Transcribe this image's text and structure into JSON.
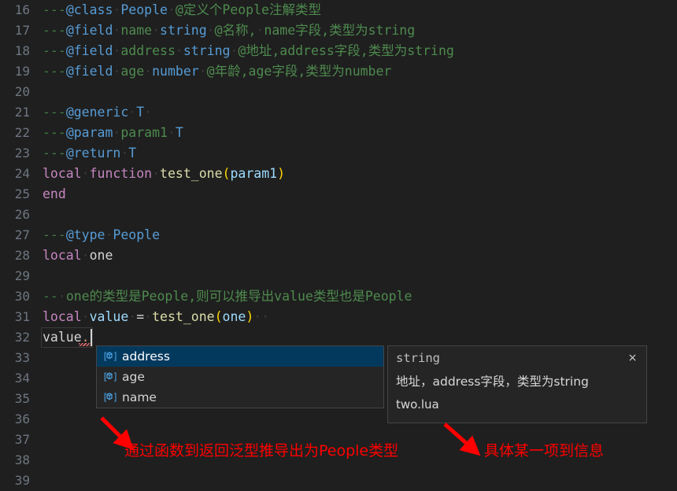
{
  "editor": {
    "language": "lua",
    "theme": "dark",
    "background": "#1f1f1f",
    "gutter_color": "#6e7681",
    "first_line": 16,
    "last_line": 39,
    "lines": [
      {
        "num": "16",
        "tokens": [
          {
            "t": "---",
            "c": "t-dash"
          },
          {
            "t": "@class",
            "c": "t-tag"
          },
          {
            "t": "·",
            "c": "t-ws"
          },
          {
            "t": "People",
            "c": "t-type"
          },
          {
            "t": "·",
            "c": "t-ws"
          },
          {
            "t": "@定义个People注解类型",
            "c": "t-cmt"
          }
        ]
      },
      {
        "num": "17",
        "tokens": [
          {
            "t": "---",
            "c": "t-dash"
          },
          {
            "t": "@field",
            "c": "t-tag"
          },
          {
            "t": "·",
            "c": "t-ws"
          },
          {
            "t": "name",
            "c": "t-param"
          },
          {
            "t": "·",
            "c": "t-ws"
          },
          {
            "t": "string",
            "c": "t-type"
          },
          {
            "t": "·",
            "c": "t-ws"
          },
          {
            "t": "@名称,",
            "c": "t-cmt"
          },
          {
            "t": "·",
            "c": "t-ws"
          },
          {
            "t": "name字段,类型为string",
            "c": "t-cmt"
          }
        ]
      },
      {
        "num": "18",
        "tokens": [
          {
            "t": "---",
            "c": "t-dash"
          },
          {
            "t": "@field",
            "c": "t-tag"
          },
          {
            "t": "·",
            "c": "t-ws"
          },
          {
            "t": "address",
            "c": "t-param"
          },
          {
            "t": "·",
            "c": "t-ws"
          },
          {
            "t": "string",
            "c": "t-type"
          },
          {
            "t": "·",
            "c": "t-ws"
          },
          {
            "t": "@地址,address字段,类型为string",
            "c": "t-cmt"
          }
        ]
      },
      {
        "num": "19",
        "tokens": [
          {
            "t": "---",
            "c": "t-dash"
          },
          {
            "t": "@field",
            "c": "t-tag"
          },
          {
            "t": "·",
            "c": "t-ws"
          },
          {
            "t": "age",
            "c": "t-param"
          },
          {
            "t": "·",
            "c": "t-ws"
          },
          {
            "t": "number",
            "c": "t-type"
          },
          {
            "t": "·",
            "c": "t-ws"
          },
          {
            "t": "@年龄,age字段,类型为number",
            "c": "t-cmt"
          }
        ]
      },
      {
        "num": "20",
        "tokens": []
      },
      {
        "num": "21",
        "tokens": [
          {
            "t": "---",
            "c": "t-dash"
          },
          {
            "t": "@generic",
            "c": "t-tag"
          },
          {
            "t": "·",
            "c": "t-ws"
          },
          {
            "t": "T",
            "c": "t-type"
          },
          {
            "t": "·",
            "c": "t-ws"
          }
        ]
      },
      {
        "num": "22",
        "tokens": [
          {
            "t": "---",
            "c": "t-dash"
          },
          {
            "t": "@param",
            "c": "t-tag"
          },
          {
            "t": "·",
            "c": "t-ws"
          },
          {
            "t": "param1",
            "c": "t-param"
          },
          {
            "t": "·",
            "c": "t-ws"
          },
          {
            "t": "T",
            "c": "t-type"
          }
        ]
      },
      {
        "num": "23",
        "tokens": [
          {
            "t": "---",
            "c": "t-dash"
          },
          {
            "t": "@return",
            "c": "t-tag"
          },
          {
            "t": "·",
            "c": "t-ws"
          },
          {
            "t": "T",
            "c": "t-type"
          }
        ]
      },
      {
        "num": "24",
        "tokens": [
          {
            "t": "local",
            "c": "t-kw"
          },
          {
            "t": "·",
            "c": "t-ws"
          },
          {
            "t": "function",
            "c": "t-kw"
          },
          {
            "t": "·",
            "c": "t-ws"
          },
          {
            "t": "test_one",
            "c": "t-fn"
          },
          {
            "t": "(",
            "c": "t-paren"
          },
          {
            "t": "param1",
            "c": "t-var"
          },
          {
            "t": ")",
            "c": "t-paren"
          }
        ]
      },
      {
        "num": "25",
        "tokens": [
          {
            "t": "end",
            "c": "t-kw"
          }
        ]
      },
      {
        "num": "26",
        "tokens": []
      },
      {
        "num": "27",
        "tokens": [
          {
            "t": "---",
            "c": "t-dash"
          },
          {
            "t": "@type",
            "c": "t-tag"
          },
          {
            "t": "·",
            "c": "t-ws"
          },
          {
            "t": "People",
            "c": "t-type"
          }
        ]
      },
      {
        "num": "28",
        "tokens": [
          {
            "t": "local",
            "c": "t-kw"
          },
          {
            "t": "·",
            "c": "t-ws"
          },
          {
            "t": "one",
            "c": "t-plain"
          }
        ]
      },
      {
        "num": "29",
        "tokens": []
      },
      {
        "num": "30",
        "tokens": [
          {
            "t": "--",
            "c": "t-dash"
          },
          {
            "t": "·",
            "c": "t-ws"
          },
          {
            "t": "one的类型是People,则可以推导出value类型也是People",
            "c": "t-cmt"
          }
        ]
      },
      {
        "num": "31",
        "tokens": [
          {
            "t": "local",
            "c": "t-kw"
          },
          {
            "t": "·",
            "c": "t-ws"
          },
          {
            "t": "value",
            "c": "t-var"
          },
          {
            "t": "·",
            "c": "t-ws"
          },
          {
            "t": "=",
            "c": "t-op"
          },
          {
            "t": "·",
            "c": "t-ws"
          },
          {
            "t": "test_one",
            "c": "t-fn"
          },
          {
            "t": "(",
            "c": "t-paren"
          },
          {
            "t": "one",
            "c": "t-var"
          },
          {
            "t": ")",
            "c": "t-paren"
          },
          {
            "t": "··",
            "c": "t-ws"
          }
        ]
      },
      {
        "num": "32",
        "tokens": [
          {
            "t": "value",
            "c": "t-plain"
          },
          {
            "t": ".",
            "c": "t-dot"
          }
        ]
      },
      {
        "num": "33",
        "tokens": []
      },
      {
        "num": "34",
        "tokens": []
      },
      {
        "num": "35",
        "tokens": []
      },
      {
        "num": "36",
        "tokens": []
      },
      {
        "num": "37",
        "tokens": []
      },
      {
        "num": "38",
        "tokens": []
      },
      {
        "num": "39",
        "tokens": []
      }
    ]
  },
  "completion": {
    "selected_index": 0,
    "selected_color": "#04395e",
    "items": [
      {
        "icon": "field-icon",
        "label": "address"
      },
      {
        "icon": "field-icon",
        "label": "age"
      },
      {
        "icon": "field-icon",
        "label": "name"
      }
    ]
  },
  "documentation": {
    "type": "string",
    "description": "地址，address字段，类型为string",
    "file": "two.lua",
    "close_label": "×"
  },
  "annotations": [
    {
      "name": "annotation-generic-inference",
      "text": "通过函数到返回泛型推导出为People类型",
      "color": "#fe0000"
    },
    {
      "name": "annotation-item-detail",
      "text": "具体某一项到信息",
      "color": "#fe0000"
    }
  ]
}
